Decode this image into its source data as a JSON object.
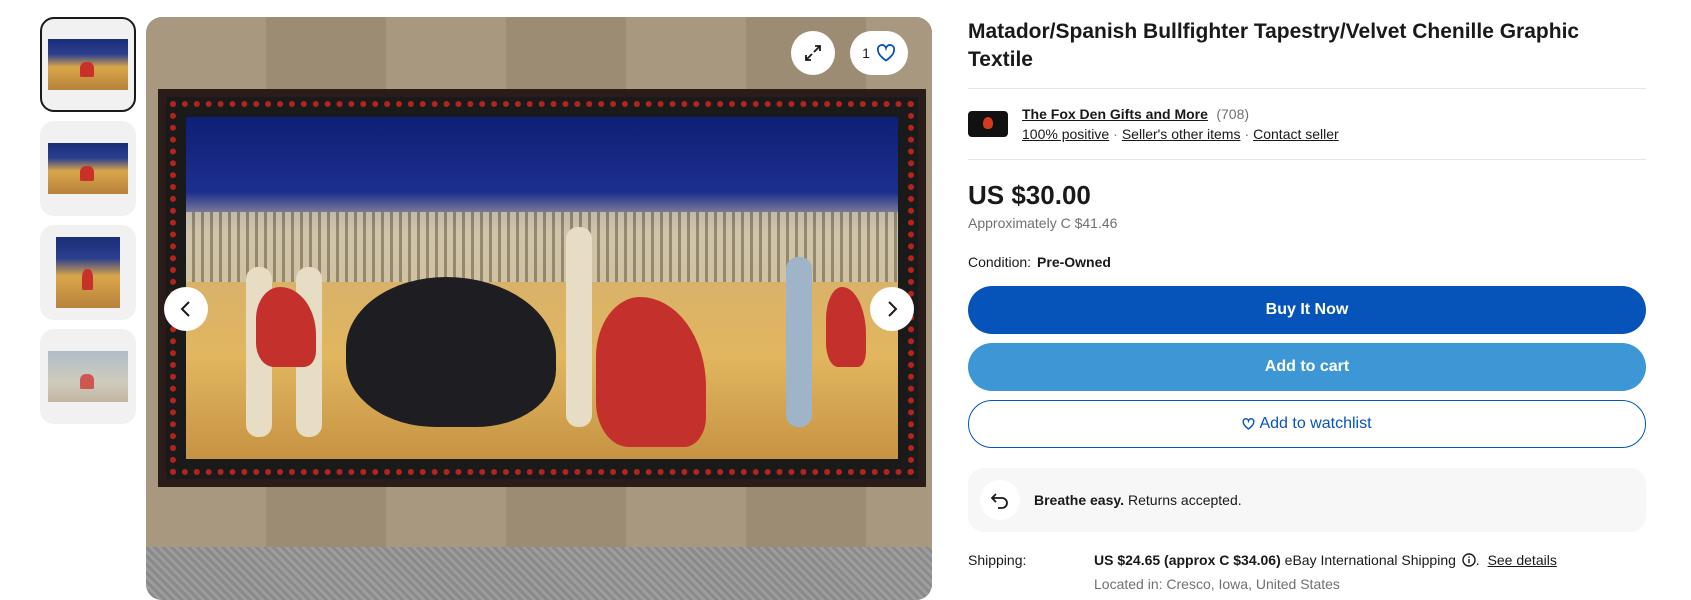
{
  "gallery": {
    "thumbnails": [
      {
        "icon": "tapestry-photo-1"
      },
      {
        "icon": "tapestry-photo-2"
      },
      {
        "icon": "tapestry-photo-3"
      },
      {
        "icon": "tapestry-photo-4"
      }
    ],
    "watch_count": "1"
  },
  "listing": {
    "title": "Matador/Spanish Bullfighter Tapestry/Velvet Chenille Graphic Textile",
    "price": "US $30.00",
    "approx_price": "Approximately C $41.46",
    "condition_label": "Condition:",
    "condition_value": "Pre-Owned"
  },
  "seller": {
    "name": "The Fox Den Gifts and More",
    "feedback_count": "(708)",
    "positive": "100% positive",
    "other_items": "Seller's other items",
    "contact": "Contact seller"
  },
  "actions": {
    "buy_now": "Buy It Now",
    "add_to_cart": "Add to cart",
    "watchlist": "Add to watchlist"
  },
  "returns": {
    "bold": "Breathe easy.",
    "text": "Returns accepted."
  },
  "shipping": {
    "label": "Shipping:",
    "cost": "US $24.65 (approx C $34.06)",
    "method": "eBay International Shipping",
    "details_link": "See details",
    "location": "Located in: Cresco, Iowa, United States"
  },
  "colors": {
    "buy_now": "#0654ba",
    "add_to_cart": "#3d97d4"
  }
}
